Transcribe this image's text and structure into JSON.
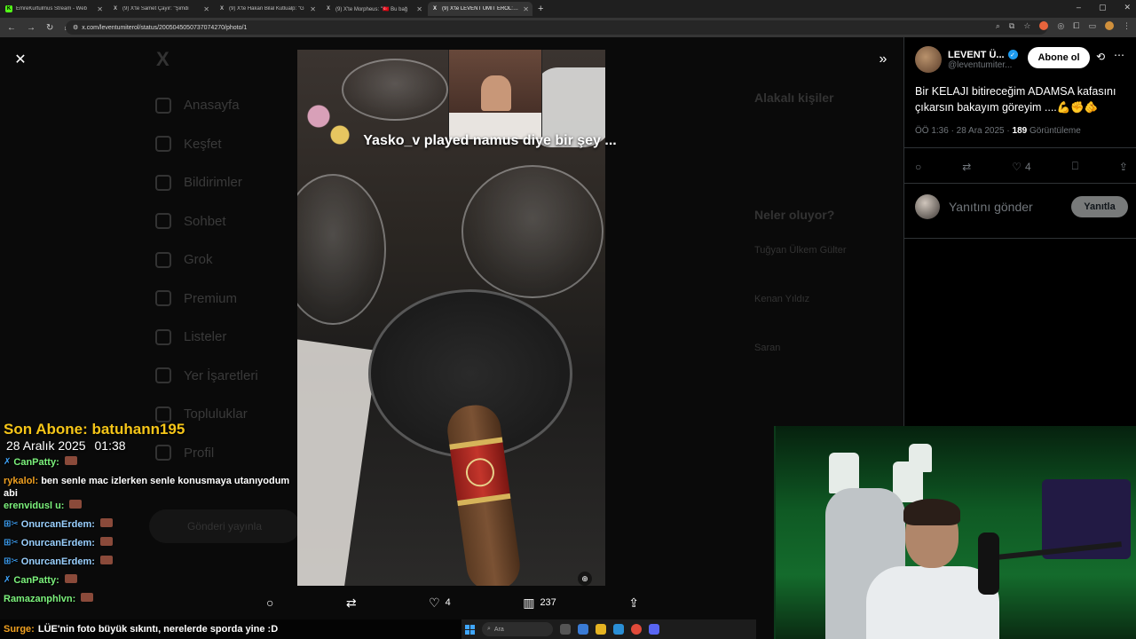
{
  "browser": {
    "tabs": [
      {
        "title": "EmreKurtulmus Stream - Web",
        "favicon": "K",
        "color": "#53fc18",
        "active": false
      },
      {
        "title": "(9) X'te Samet Çayır: \"Şimdi",
        "favicon": "X",
        "color": "#ffffff",
        "active": false
      },
      {
        "title": "(9) X'te Hakan Bilal Kutlualp: \"G",
        "favicon": "X",
        "color": "#ffffff",
        "active": false
      },
      {
        "title": "(9) X'te Morpheus: \"🇹🇷 Bu bağ",
        "favicon": "X",
        "color": "#ffffff",
        "active": false
      },
      {
        "title": "(9) X'te LEVENT ÜMİT EROL: \"Bi",
        "favicon": "X",
        "color": "#ffffff",
        "active": true
      }
    ],
    "new_tab": "+",
    "window_controls": [
      "–",
      "▢",
      "✕"
    ],
    "url": "x.com/leventumiterol/status/2005045050737074270/photo/1",
    "nav_icons": [
      "←",
      "→",
      "↻",
      "⌂"
    ]
  },
  "background_nav": {
    "logo": "X",
    "items": [
      "Anasayfa",
      "Keşfet",
      "Bildirimler",
      "Sohbet",
      "Grok",
      "Premium",
      "Listeler",
      "Yer İşaretleri",
      "Topluluklar",
      "Profil"
    ],
    "post_button": "Gönderi yayınla"
  },
  "background_right": {
    "related_title": "Alakalı kişiler",
    "trending_title": "Neler oluyor?",
    "trends": [
      "Tuğyan Ülkem Gülter",
      "Kenan Yıldız",
      "Saran"
    ]
  },
  "photo": {
    "caption_overlay": "Yasko_v played namus diye bir şey ...",
    "close_icon": "✕",
    "expand_icon": "»"
  },
  "photo_actions": {
    "reply": "",
    "retweet": "",
    "likes": "4",
    "views": "237",
    "share": ""
  },
  "tweet": {
    "author_name": "LEVENT Ü...",
    "handle": "@leventumiter...",
    "follow_label": "Abone ol",
    "text": "Bir KELAJI bitireceğim ADAMSA kafasını çıkarsın bakayım göreyim ....💪✊🫵",
    "time": "ÖÖ 1:36 · 28 Ara 2025 · ",
    "views_count": "189",
    "views_label": " Görüntüleme",
    "likes": "4",
    "reply_placeholder": "Yanıtını gönder",
    "reply_button": "Yanıtla"
  },
  "stream": {
    "last_sub": "Son Abone: batuhann195",
    "date": "28 Aralık 2025",
    "clock": "01:38",
    "chat": [
      {
        "user": "CanPatty:",
        "color": "#7cf27c",
        "message": "",
        "prefix": "✗"
      },
      {
        "user": "rykalol:",
        "color": "#f0a020",
        "message": "ben senle mac izlerken senle konusmaya utanıyodum abi",
        "prefix": ""
      },
      {
        "user": "erenvidusl u:",
        "color": "#7cf27c",
        "message": "",
        "prefix": ""
      },
      {
        "user": "OnurcanErdem:",
        "color": "#9ad0ff",
        "message": "",
        "prefix": "⊞✂"
      },
      {
        "user": "OnurcanErdem:",
        "color": "#9ad0ff",
        "message": "",
        "prefix": "⊞✂"
      },
      {
        "user": "OnurcanErdem:",
        "color": "#9ad0ff",
        "message": "",
        "prefix": "⊞✂"
      },
      {
        "user": "CanPatty:",
        "color": "#7cf27c",
        "message": "",
        "prefix": "✗"
      },
      {
        "user": "Ramazanphlvn:",
        "color": "#7cf27c",
        "message": "",
        "prefix": ""
      }
    ],
    "bottom_user": "Surge:",
    "bottom_message": "LÜE'nin foto büyük sıkıntı, nerelerde sporda yine :D"
  },
  "taskbar": {
    "search": "Ara"
  }
}
